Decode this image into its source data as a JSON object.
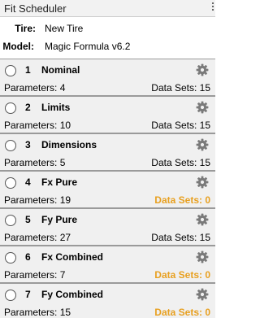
{
  "window": {
    "title": "Fit Scheduler"
  },
  "info": {
    "tire_label": "Tire:",
    "tire_value": "New Tire",
    "model_label": "Model:",
    "model_value": "Magic Formula v6.2"
  },
  "colors": {
    "card_background": "#f0f0f0",
    "zero_datasets": "#e8a020",
    "card_border": "#9a9a9a"
  },
  "steps": [
    {
      "number": "1",
      "name": "Nominal",
      "parameters_text": "Parameters: 4",
      "datasets_text": "Data Sets: 15",
      "datasets_zero": false
    },
    {
      "number": "2",
      "name": "Limits",
      "parameters_text": "Parameters: 10",
      "datasets_text": "Data Sets: 15",
      "datasets_zero": false
    },
    {
      "number": "3",
      "name": "Dimensions",
      "parameters_text": "Parameters: 5",
      "datasets_text": "Data Sets: 15",
      "datasets_zero": false
    },
    {
      "number": "4",
      "name": "Fx Pure",
      "parameters_text": "Parameters: 19",
      "datasets_text": "Data Sets: 0",
      "datasets_zero": true
    },
    {
      "number": "5",
      "name": "Fy Pure",
      "parameters_text": "Parameters: 27",
      "datasets_text": "Data Sets: 15",
      "datasets_zero": false
    },
    {
      "number": "6",
      "name": "Fx Combined",
      "parameters_text": "Parameters: 7",
      "datasets_text": "Data Sets: 0",
      "datasets_zero": true
    },
    {
      "number": "7",
      "name": "Fy Combined",
      "parameters_text": "Parameters: 15",
      "datasets_text": "Data Sets: 0",
      "datasets_zero": true
    }
  ],
  "icons": {
    "step_settings": "gear-icon",
    "step_select": "radio-button",
    "panel_menu": "kebab-menu-icon"
  }
}
